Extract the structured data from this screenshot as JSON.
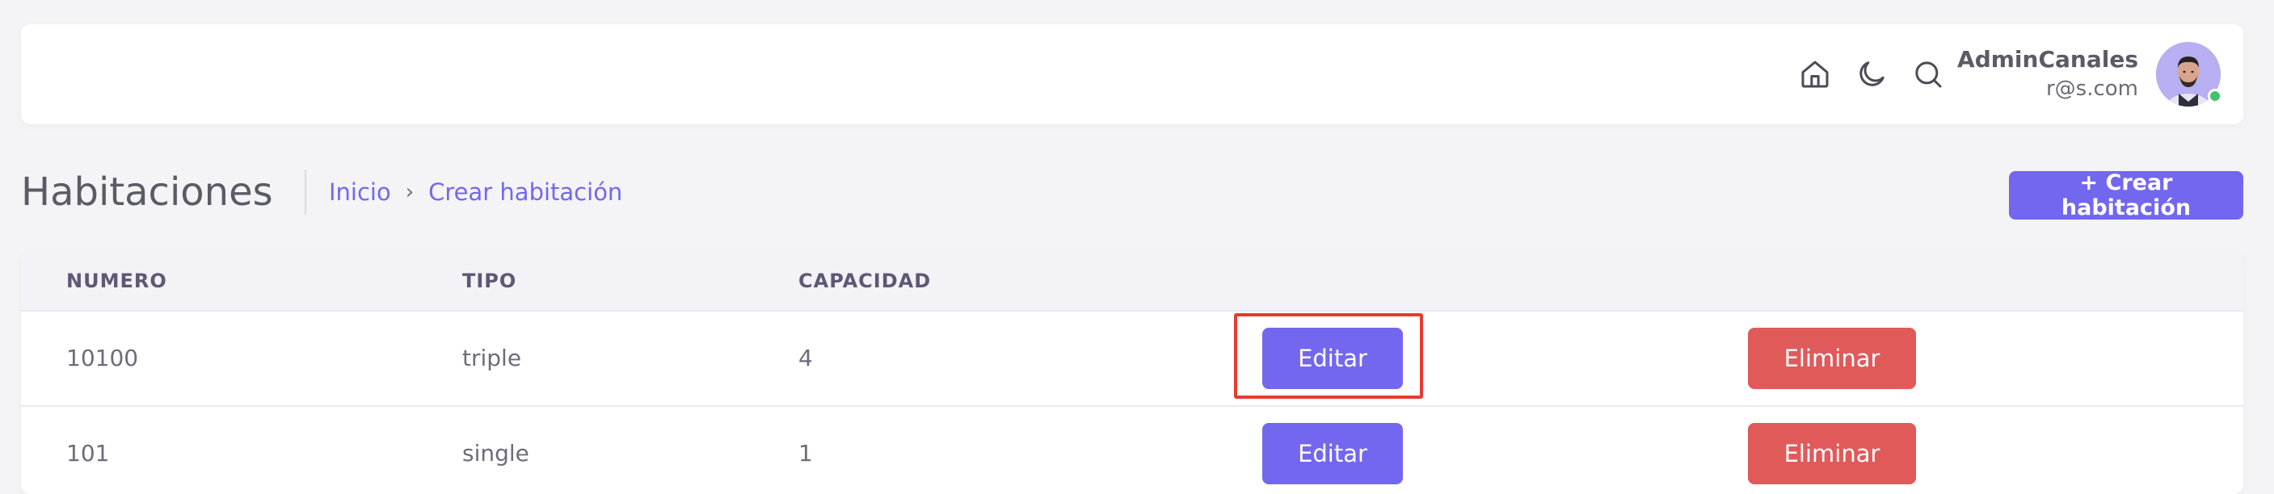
{
  "user": {
    "name": "AdminCanales",
    "email": "r@s.com"
  },
  "nav_icons": [
    "home-icon",
    "moon-icon",
    "search-icon"
  ],
  "page": {
    "title": "Habitaciones",
    "breadcrumb": [
      "Inicio",
      "Crear habitación"
    ],
    "create_button": "+ Crear habitación"
  },
  "table": {
    "headers": [
      "NUMERO",
      "TIPO",
      "CAPACIDAD"
    ],
    "rows": [
      {
        "numero": "10100",
        "tipo": "triple",
        "capacidad": "4",
        "edit": "Editar",
        "delete": "Eliminar"
      },
      {
        "numero": "101",
        "tipo": "single",
        "capacidad": "1",
        "edit": "Editar",
        "delete": "Eliminar"
      }
    ]
  },
  "colors": {
    "accent": "#7367f0",
    "danger": "#e15a5a",
    "highlight": "#e83a2e",
    "online": "#41c26b"
  }
}
